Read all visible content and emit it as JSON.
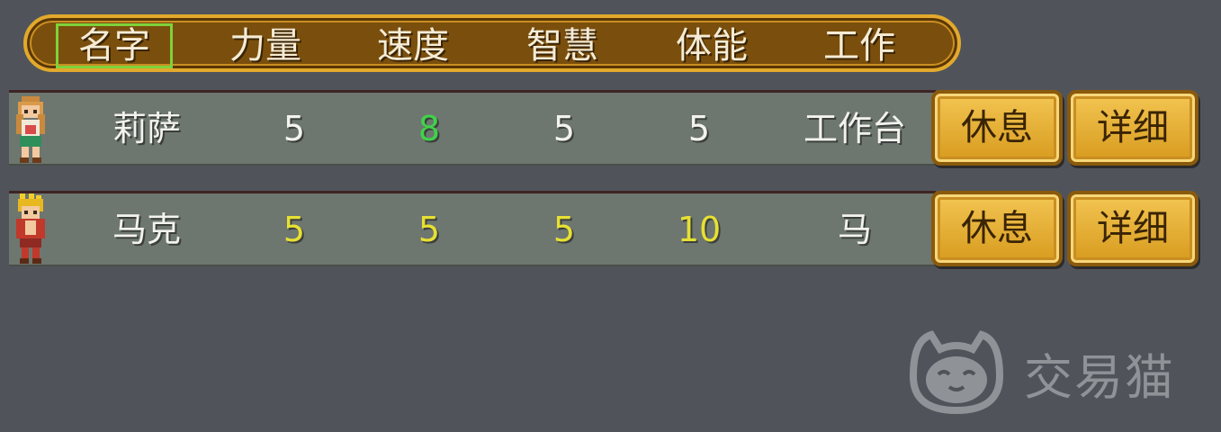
{
  "header": {
    "columns": [
      "名字",
      "力量",
      "速度",
      "智慧",
      "体能",
      "工作"
    ],
    "selected_index": 0
  },
  "rows": [
    {
      "name": "莉萨",
      "strength": "5",
      "speed": "8",
      "wisdom": "5",
      "stamina": "5",
      "job": "工作台",
      "rest_label": "休息",
      "detail_label": "详细",
      "colors": {
        "strength": "#f2f2ee",
        "speed": "#3fd34a",
        "wisdom": "#f2f2ee",
        "stamina": "#f2f2ee"
      },
      "avatar_icon": "character-lisa-icon"
    },
    {
      "name": "马克",
      "strength": "5",
      "speed": "5",
      "wisdom": "5",
      "stamina": "10",
      "job": "马",
      "rest_label": "休息",
      "detail_label": "详细",
      "colors": {
        "strength": "#e6e033",
        "speed": "#e6e033",
        "wisdom": "#e6e033",
        "stamina": "#e6e033"
      },
      "avatar_icon": "character-mark-icon"
    }
  ],
  "watermark": {
    "text": "交易猫",
    "icon": "cat-logo-icon"
  },
  "colors": {
    "background": "#50545a",
    "header_fill": "#7a4f0d",
    "header_border": "#e2a92c",
    "button_fill": "#e4ad36",
    "selection": "#7ed23a"
  }
}
